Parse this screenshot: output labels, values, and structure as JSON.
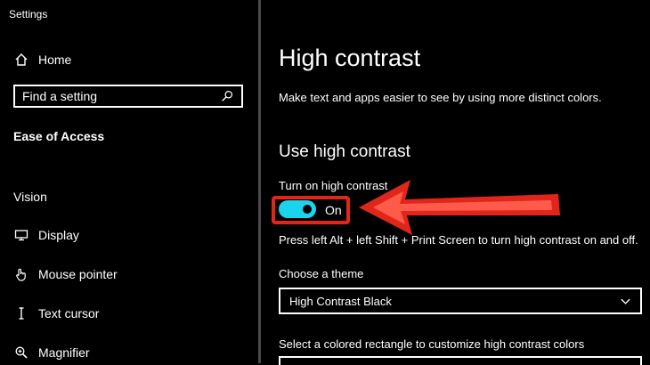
{
  "window": {
    "title": "Settings"
  },
  "sidebar": {
    "home_label": "Home",
    "search_placeholder": "Find a setting",
    "section_title": "Ease of Access",
    "group_title": "Vision",
    "items": [
      {
        "label": "Display",
        "icon": "monitor-icon"
      },
      {
        "label": "Mouse pointer",
        "icon": "mouse-pointer-icon"
      },
      {
        "label": "Text cursor",
        "icon": "text-cursor-icon"
      },
      {
        "label": "Magnifier",
        "icon": "magnifier-icon"
      }
    ]
  },
  "main": {
    "title": "High contrast",
    "description": "Make text and apps easier to see by using more distinct colors.",
    "section_title": "Use high contrast",
    "toggle_label": "Turn on high contrast",
    "toggle_state": "On",
    "shortcut_text": "Press left Alt + left Shift + Print Screen to turn high contrast on and off.",
    "theme_label": "Choose a theme",
    "theme_value": "High Contrast Black",
    "rect_label": "Select a colored rectangle to customize high contrast colors"
  },
  "colors": {
    "toggle_on": "#1bd3ec",
    "highlight": "#e0261b",
    "background": "#000000"
  }
}
